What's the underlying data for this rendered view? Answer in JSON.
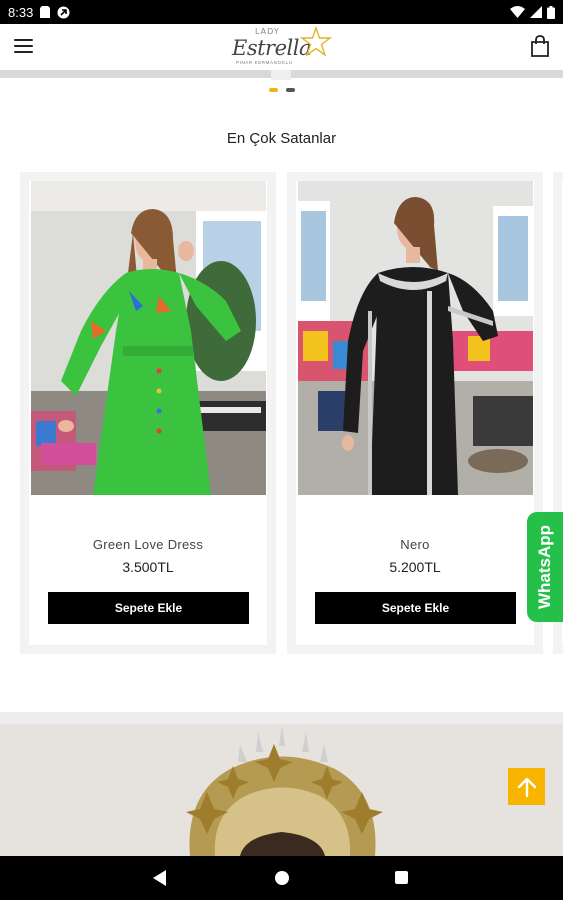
{
  "status_bar": {
    "time": "8:33"
  },
  "header": {
    "logo": {
      "top": "LADY",
      "main": "Estrella",
      "sub": "PINAR KERMANOGLU"
    }
  },
  "slider": {
    "dot_active_color": "#f2b31a",
    "dot_inactive_color": "#555555"
  },
  "section": {
    "title": "En Çok Satanlar"
  },
  "products": [
    {
      "name": "Green Love Dress",
      "price": "3.500TL",
      "button_label": "Sepete Ekle"
    },
    {
      "name": "Nero",
      "price": "5.200TL",
      "button_label": "Sepete Ekle"
    }
  ],
  "whatsapp": {
    "label": "WhatsApp",
    "color": "#25c04a"
  },
  "scroll_top": {
    "icon": "arrow-up-icon",
    "color": "#f7b500"
  }
}
